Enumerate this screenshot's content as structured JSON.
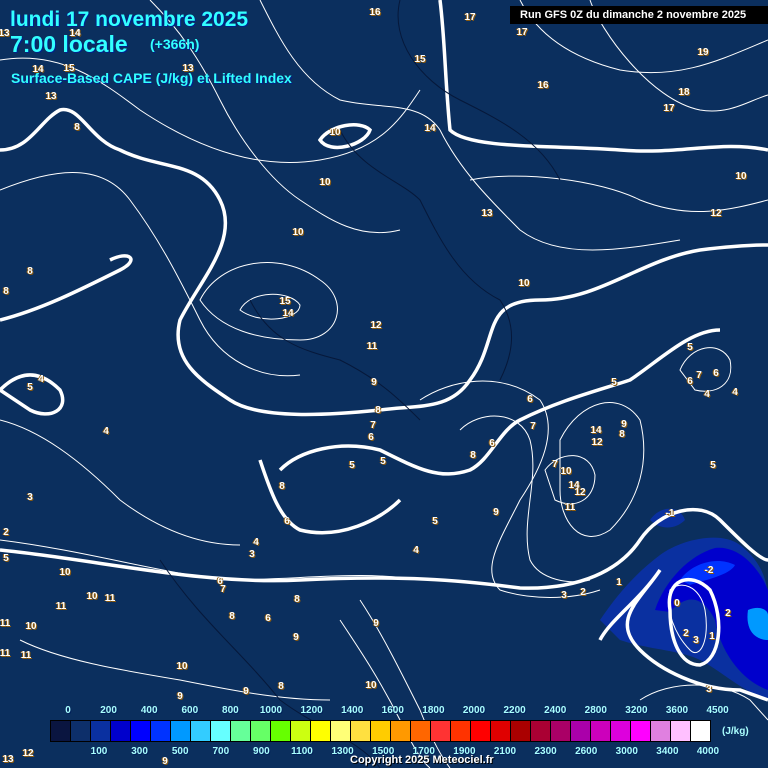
{
  "header": {
    "date": "lundi 17 novembre 2025",
    "time": "7:00 locale",
    "lead": "(+366h)",
    "parameter": "Surface-Based CAPE (J/kg) et Lifted Index",
    "run": "Run GFS 0Z du dimanche 2 novembre 2025"
  },
  "colorbar": {
    "unit": "(J/kg)",
    "top_labels": [
      "0",
      "200",
      "400",
      "600",
      "800",
      "1000",
      "1200",
      "1400",
      "1600",
      "1800",
      "2000",
      "2200",
      "2400",
      "2800",
      "3200",
      "3600",
      "4500"
    ],
    "bottom_labels": [
      "100",
      "300",
      "500",
      "700",
      "900",
      "1100",
      "1300",
      "1500",
      "1700",
      "1900",
      "2100",
      "2300",
      "2600",
      "3000",
      "3400",
      "4000"
    ],
    "colors": [
      "#0a1540",
      "#0d2f6a",
      "#0a30a0",
      "#0000cc",
      "#0000ff",
      "#0033ff",
      "#0099ff",
      "#33ccff",
      "#66ffff",
      "#66ff99",
      "#66ff66",
      "#66ff00",
      "#ccff11",
      "#ffff00",
      "#ffff77",
      "#ffe040",
      "#ffcc00",
      "#ff9900",
      "#ff6600",
      "#ff3333",
      "#ff3300",
      "#ff0000",
      "#e00000",
      "#aa0000",
      "#aa0033",
      "#aa0066",
      "#aa00aa",
      "#cc00bb",
      "#dd00dd",
      "#ff00ff",
      "#e080e0",
      "#ffc0ff",
      "#ffffff"
    ]
  },
  "copyright": "Copyright 2025 Meteociel.fr",
  "map": {
    "labels": [
      "16",
      "17",
      "17",
      "15",
      "16",
      "19",
      "18",
      "17",
      "14",
      "10",
      "10",
      "13",
      "12",
      "10",
      "10",
      "10",
      "15",
      "14",
      "12",
      "11",
      "9",
      "8",
      "7",
      "6",
      "5",
      "5",
      "4",
      "4",
      "6",
      "6",
      "8",
      "7",
      "5",
      "5",
      "8",
      "9",
      "5",
      "6",
      "4",
      "3",
      "4",
      "-1",
      "5",
      "1",
      "2",
      "3",
      "-2",
      "0",
      "2",
      "2",
      "3",
      "1",
      "3",
      "10",
      "10",
      "11",
      "11",
      "10",
      "11",
      "11",
      "11",
      "8",
      "6",
      "8",
      "9",
      "9",
      "10",
      "8",
      "9",
      "10",
      "9",
      "8",
      "13",
      "8",
      "8",
      "4",
      "5",
      "4",
      "3",
      "2",
      "5",
      "13",
      "14",
      "13",
      "15",
      "14",
      "7",
      "6",
      "12",
      "13",
      "9",
      "14",
      "12",
      "9",
      "8",
      "7",
      "10",
      "14",
      "12",
      "11",
      "6",
      "7",
      "6"
    ]
  }
}
